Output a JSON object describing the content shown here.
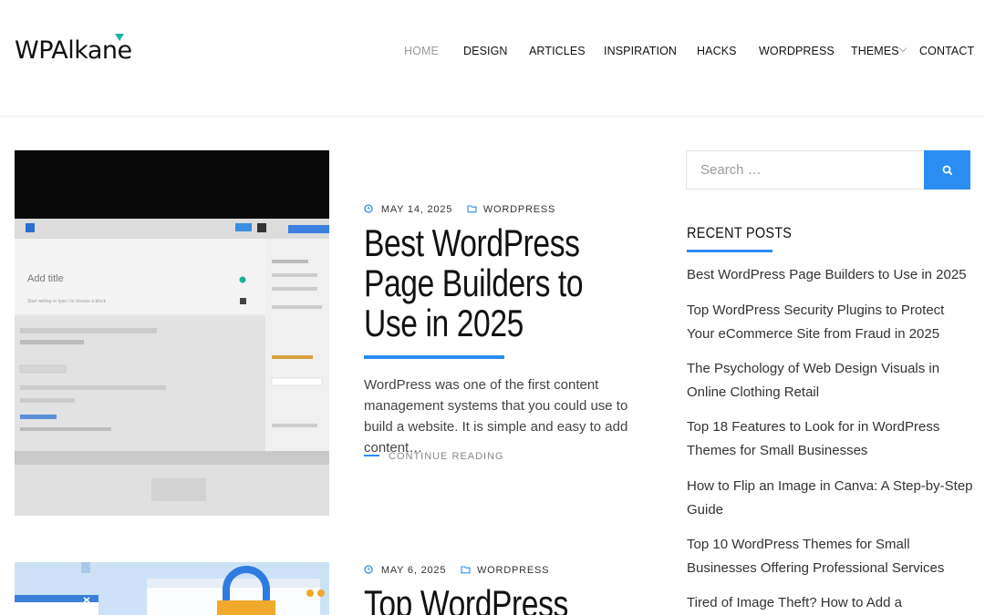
{
  "site": {
    "logo": "WPAlkane"
  },
  "nav": {
    "items": [
      {
        "label": "HOME",
        "active": true
      },
      {
        "label": "DESIGN"
      },
      {
        "label": "ARTICLES"
      },
      {
        "label": "INSPIRATION"
      },
      {
        "label": "HACKS"
      },
      {
        "label": "WORDPRESS"
      },
      {
        "label": "THEMES",
        "has_dropdown": true
      },
      {
        "label": "CONTACT"
      }
    ]
  },
  "posts": [
    {
      "date": "MAY 14, 2025",
      "category": "WORDPRESS",
      "title": "Best WordPress Page Builders to Use in 2025",
      "excerpt": "WordPress was one of the first content management systems that you could use to build a website. It is simple and easy to add content…",
      "read_more": "CONTINUE READING",
      "image_text": {
        "add_title": "Add title",
        "block_hint": "Start writing or type / to choose a block"
      }
    },
    {
      "date": "MAY 6, 2025",
      "category": "WORDPRESS",
      "title": "Top WordPress"
    }
  ],
  "sidebar": {
    "search_placeholder": "Search …",
    "recent_title": "RECENT POSTS",
    "recent_posts": [
      "Best WordPress Page Builders to Use in 2025",
      "Top WordPress Security Plugins to Protect Your eCommerce Site from Fraud in 2025",
      "The Psychology of Web Design Visuals in Online Clothing Retail",
      "Top 18 Features to Look for in WordPress Themes for Small Businesses",
      "How to Flip an Image in Canva: A Step-by-Step Guide",
      "Top 10 WordPress Themes for Small Businesses Offering Professional Services",
      "Tired of Image Theft? How to Add a"
    ]
  },
  "colors": {
    "accent": "#2b8df2",
    "logo_accent": "#1bb3a5",
    "nav_active": "#9a9a9a"
  }
}
